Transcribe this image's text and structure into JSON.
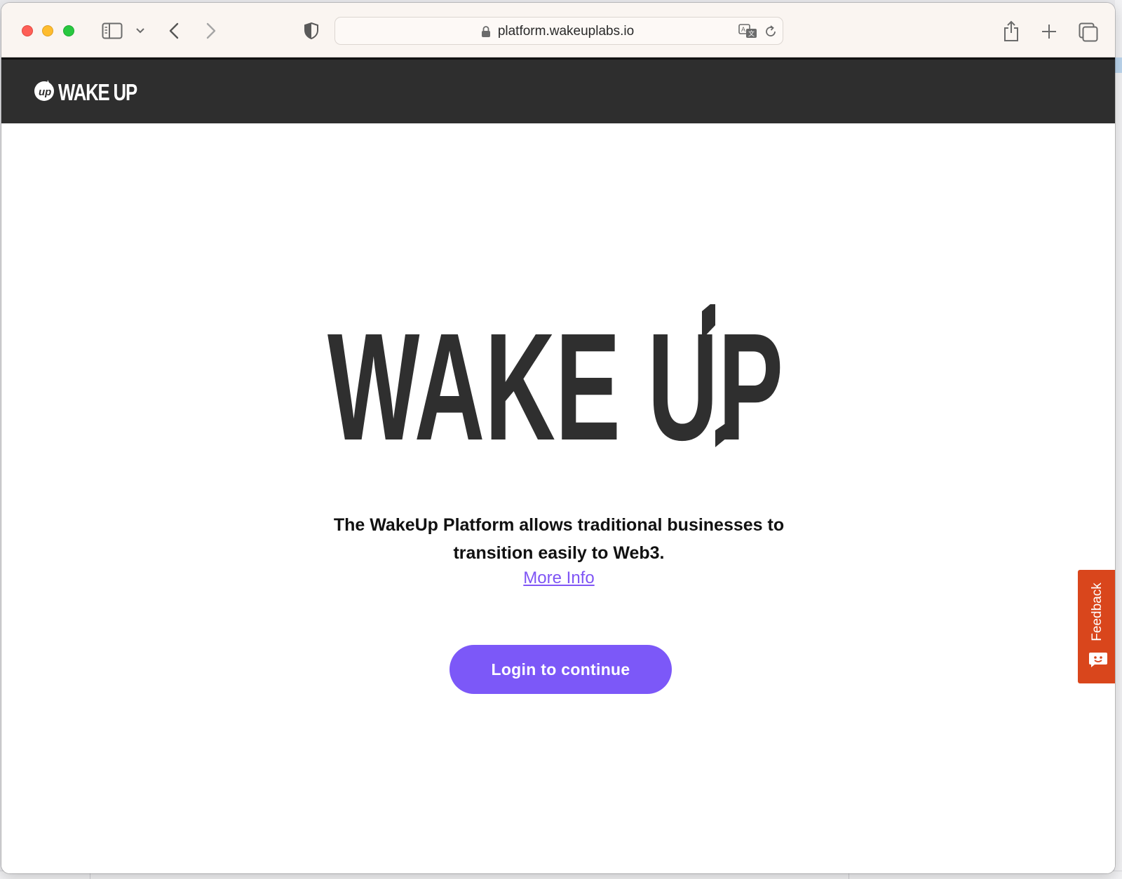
{
  "browser": {
    "url": "platform.wakeuplabs.io",
    "icons": [
      "close-icon",
      "minimize-icon",
      "zoom-icon",
      "sidebar-icon",
      "chevron-down-icon",
      "back-icon",
      "forward-icon",
      "shield-icon",
      "lock-icon",
      "translate-icon",
      "reload-icon",
      "share-icon",
      "new-tab-icon",
      "tab-overview-icon"
    ]
  },
  "header": {
    "logo_text": "WAKE UP"
  },
  "main": {
    "hero_logo_text": "WAKE UP",
    "tagline_line1": "The WakeUp Platform allows traditional businesses to",
    "tagline_line2": "transition easily to Web3.",
    "more_info_link": "More Info",
    "login_button": "Login to continue"
  },
  "feedback": {
    "label": "Feedback"
  },
  "colors": {
    "header_bg": "#2e2e2e",
    "accent": "#7c58f8",
    "feedback_bg": "#d9461c",
    "logo_dark": "#2f2f2f"
  }
}
